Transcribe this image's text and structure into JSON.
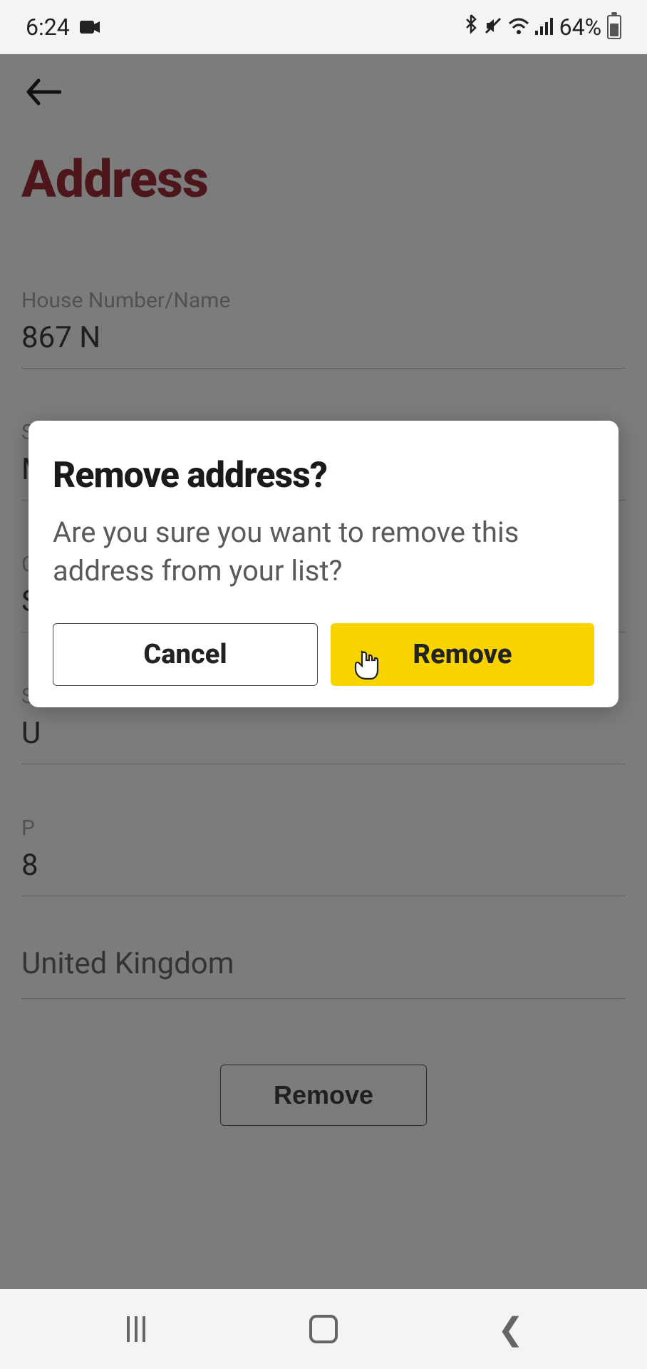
{
  "status": {
    "time": "6:24",
    "battery_pct": "64%"
  },
  "page": {
    "title": "Address",
    "remove_button": "Remove"
  },
  "fields": {
    "house": {
      "label": "House Number/Name",
      "value": "867 N"
    },
    "street": {
      "label": "Street",
      "value": "Maple Tree"
    },
    "city": {
      "label": "C",
      "value": "S"
    },
    "state": {
      "label": "S",
      "value": "U"
    },
    "postcode": {
      "label": "P",
      "value": "8"
    },
    "country": {
      "value": "United Kingdom"
    }
  },
  "dialog": {
    "title": "Remove address?",
    "body": "Are you sure you want to remove this address from your list?",
    "cancel": "Cancel",
    "confirm": "Remove"
  }
}
